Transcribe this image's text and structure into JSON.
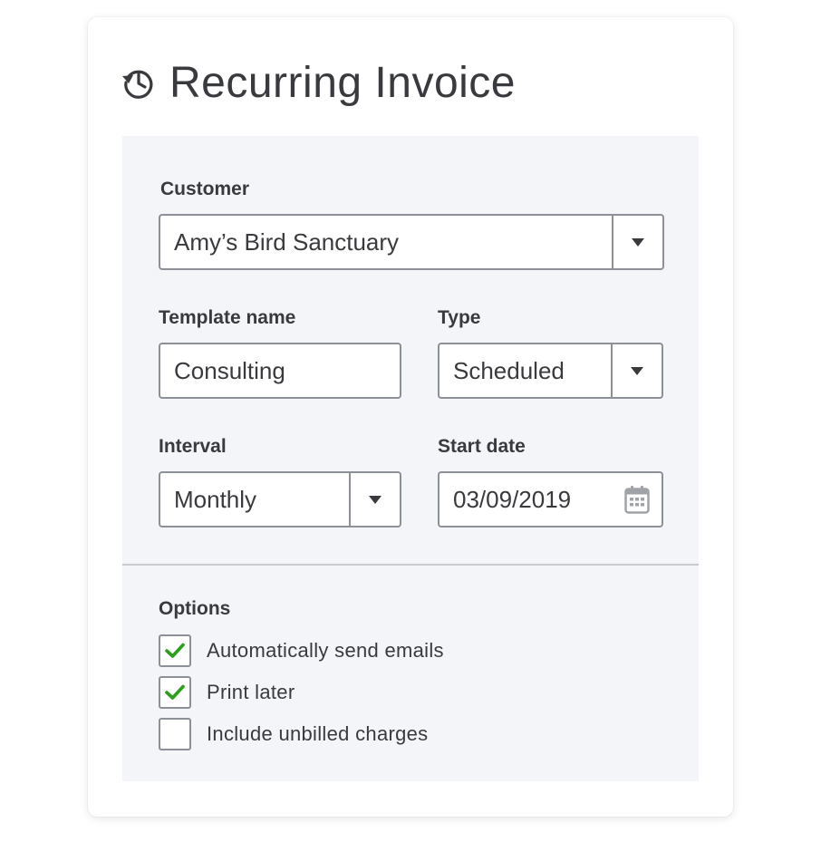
{
  "title": "Recurring Invoice",
  "customer": {
    "label": "Customer",
    "value": "Amy’s Bird Sanctuary"
  },
  "template_name": {
    "label": "Template name",
    "value": "Consulting"
  },
  "type": {
    "label": "Type",
    "value": "Scheduled"
  },
  "interval": {
    "label": "Interval",
    "value": "Monthly"
  },
  "start_date": {
    "label": "Start date",
    "value": "03/09/2019"
  },
  "options": {
    "label": "Options",
    "items": [
      {
        "label": "Automatically send emails",
        "checked": true
      },
      {
        "label": "Print later",
        "checked": true
      },
      {
        "label": "Include unbilled charges",
        "checked": false
      }
    ]
  },
  "icons": {
    "title": "history-icon",
    "dropdown": "chevron-down-icon",
    "calendar": "calendar-icon",
    "check": "checkmark-icon"
  },
  "colors": {
    "panel_bg": "#f4f5f8",
    "border": "#8d9096",
    "text": "#393a3d",
    "check": "#2ca01c"
  }
}
